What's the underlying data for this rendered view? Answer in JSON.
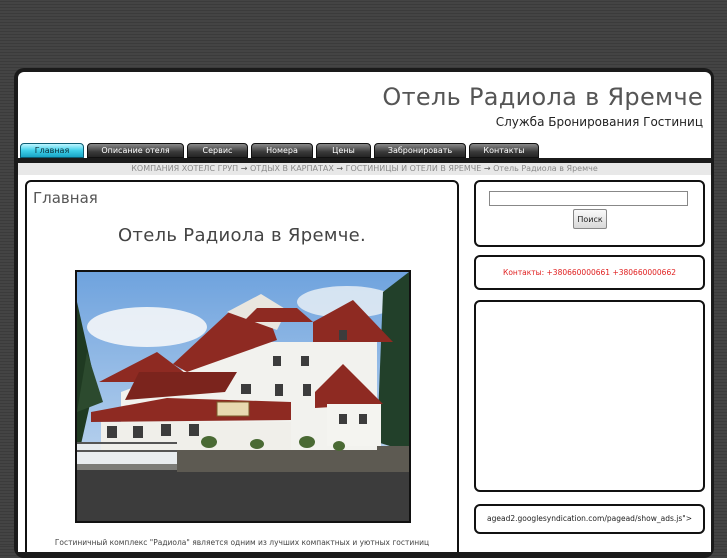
{
  "header": {
    "title": "Отель Радиола в Яремче",
    "subtitle": "Служба Бронирования Гостиниц"
  },
  "nav": {
    "tabs": [
      {
        "label": "Главная",
        "active": true
      },
      {
        "label": "Описание отеля"
      },
      {
        "label": "Сервис"
      },
      {
        "label": "Номера"
      },
      {
        "label": "Цены"
      },
      {
        "label": "Забронировать"
      },
      {
        "label": "Контакты"
      }
    ]
  },
  "breadcrumb": {
    "items": [
      "КОМПАНИЯ ХОТЕЛС ГРУП",
      "ОТДЫХ В КАРПАТАХ",
      "ГОСТИНИЦЫ И ОТЕЛИ В ЯРЕМЧЕ"
    ],
    "separator": "→",
    "current": "Отель Радиола в Яремче"
  },
  "main": {
    "heading": "Главная",
    "title": "Отель Радиола в Яремче.",
    "intro": "Гостиничный комплекс \"Радиола\" является одним из лучших компактных и уютных гостиниц"
  },
  "sidebar": {
    "search_button": "Поиск",
    "search_value": "",
    "contacts": "Контакты: +380660000661 +380660000662",
    "ad_code": "agead2.googlesyndication.com/pagead/show_ads.js\">"
  },
  "colors": {
    "active_tab": "#3fd0ea",
    "contacts_text": "#e02020",
    "background": "#3f3f3f"
  }
}
